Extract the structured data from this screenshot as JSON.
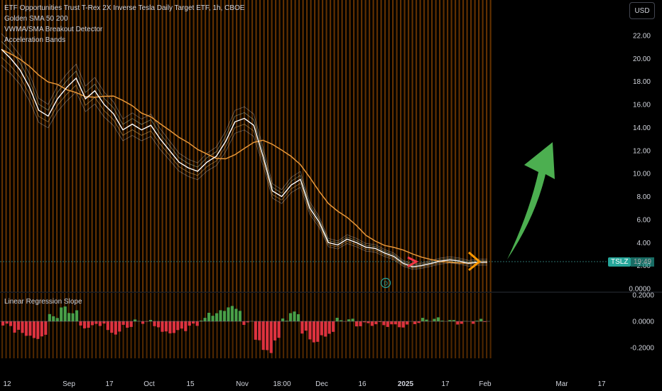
{
  "legend": {
    "title": "ETF Opportunities Trust T-Rex 2X Inverse Tesla Daily Target ETF, 1h, CBOE",
    "ind1": "Golden SMA 50 200",
    "ind2": "VWMA/SMA Breakout Detector",
    "ind3": "Acceleration Bands"
  },
  "sub_legend": "Linear Regression Slope",
  "currency": "USD",
  "price_tag": {
    "ticker": "TSLZ",
    "time": "19:49"
  },
  "div_marker": "D",
  "colors": {
    "bars_orange": "#ff7f00",
    "green": "#26a69a",
    "red": "#f23645",
    "arrow": "#4caf50"
  },
  "chart_data": [
    {
      "type": "line",
      "ylim": [
        0,
        23
      ],
      "y_ticks": [
        "22.00",
        "20.00",
        "18.00",
        "16.00",
        "14.00",
        "12.00",
        "10.00",
        "8.00",
        "6.00",
        "4.00",
        "2.00",
        "0.0000"
      ],
      "x_ticks": [
        "12",
        "Sep",
        "17",
        "Oct",
        "15",
        "Nov",
        "18:00",
        "Dec",
        "16",
        "2025",
        "17",
        "Feb",
        "Mar",
        "17"
      ],
      "series": [
        {
          "values": [
            20.8,
            20.0,
            19.0,
            17.5,
            15.5,
            15.0,
            16.5,
            17.5,
            18.3,
            16.5,
            17.2,
            16.0,
            15.2,
            13.8,
            14.3,
            13.8,
            14.2,
            13.0,
            12.0,
            11.0,
            10.5,
            10.2,
            11.0,
            11.5,
            12.8,
            14.5,
            14.8,
            14.2,
            11.5,
            8.5,
            8.0,
            9.0,
            9.5,
            7.0,
            5.8,
            4.0,
            3.8,
            4.3,
            4.0,
            3.6,
            3.5,
            3.1,
            2.8,
            2.2,
            1.9,
            2.0,
            2.2,
            2.4,
            2.5,
            2.4,
            2.2,
            2.3,
            2.3
          ]
        }
      ]
    },
    {
      "type": "bar",
      "title": "Linear Regression Slope",
      "ylim": [
        -0.3,
        0.2
      ],
      "y_ticks": [
        "0.2000",
        "0.0000",
        "-0.2000"
      ]
    }
  ]
}
